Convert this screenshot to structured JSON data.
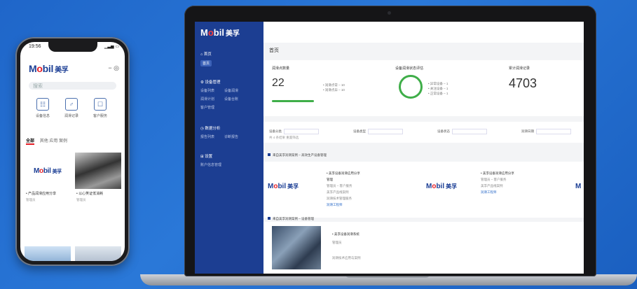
{
  "phone": {
    "status_time": "19:56",
    "status_right": "▁▃▅ ▭",
    "logo": {
      "mo": "M",
      "o": "o",
      "bil": "bil",
      "cn": "美孚"
    },
    "search_placeholder": "搜索",
    "header_icons": "−  ◎",
    "quick": [
      {
        "icon": "☷",
        "label": "设备信息"
      },
      {
        "icon": "♂",
        "label": "润滑记录"
      },
      {
        "icon": "☐",
        "label": "客户服务"
      }
    ],
    "tabs": {
      "active": "全部",
      "rest": "其他   应用   案例"
    },
    "cards": [
      {
        "title": "• 产品润滑应用分享",
        "sub": "管理员"
      },
      {
        "title": "• 以心笑证低消耗",
        "sub": "管理员"
      }
    ]
  },
  "laptop": {
    "sidebar": {
      "logo": {
        "mo": "M",
        "o": "o",
        "bil": "bil",
        "cn": "美孚"
      },
      "groups": [
        {
          "title": "首页",
          "items": [
            "首页"
          ]
        },
        {
          "title": "设备管理",
          "items": [
            "设备列表",
            "设备润滑",
            "润滑计划",
            "设备台账",
            "客户管理"
          ]
        },
        {
          "title": "数据分析",
          "items": [
            "报告列表",
            "诊断报告"
          ]
        },
        {
          "title": "设置",
          "items": [
            "账户信息管理"
          ]
        }
      ]
    },
    "page_title": "首页",
    "stats": [
      {
        "label": "润滑点数量",
        "value": "22",
        "legend": [
          "• 润滑点常 – 10",
          "• 润滑点异 – 10"
        ]
      },
      {
        "label": "设备润滑状态评估",
        "value": "",
        "legend": [
          "• 异常设备 – 1",
          "• 关注设备 – 1",
          "• 正常设备 – 1"
        ]
      },
      {
        "label": "累计润滑记录",
        "value": "4703",
        "legend": []
      }
    ],
    "filters": [
      "设备分类",
      "设备类型",
      "设备状态",
      "润滑日期"
    ],
    "filter_sub": "共 4 条结果   重置筛选",
    "section1": "来自美孚润滑案例 – 高效生产设备管理",
    "section2": "来自美孚润滑案例 – 设备管理",
    "cards": [
      {
        "title": "• 美孚设备润滑应用分享",
        "l2": "管理",
        "l3": "管理员 – 客户服务",
        "l4": "美孚产品线案例",
        "l5": "润滑技术管理服务",
        "tag": "润滑工程师"
      },
      {
        "title": "• 美孚设备润滑应用分享",
        "l2": "",
        "l3": "管理员 – 客户服务",
        "l4": "美孚产品线案例",
        "l5": "",
        "tag": "润滑工程师"
      }
    ],
    "row2": {
      "title": "• 美孚设备润滑系统",
      "l2": "管理员",
      "l3": "润滑技术应用与案例"
    }
  }
}
